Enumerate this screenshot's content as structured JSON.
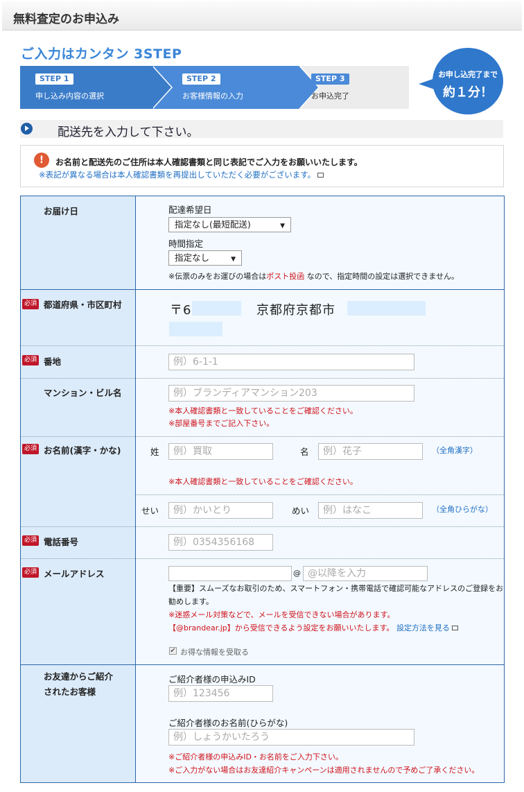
{
  "page": {
    "title": "無料査定のお申込み"
  },
  "steps": {
    "heading": "ご入力はカンタン 3STEP",
    "items": [
      {
        "badge": "STEP 1",
        "label": "申し込み内容の選択"
      },
      {
        "badge": "STEP 2",
        "label": "お客様情報の入力"
      },
      {
        "badge": "STEP 3",
        "label": "お申込完了"
      }
    ],
    "bubble_line1": "お申し込完了まで",
    "bubble_line2": "約１分！"
  },
  "section": {
    "heading": "配送先を入力して下さい。"
  },
  "notice": {
    "icon": "!",
    "line1": "お名前と配送先のご住所は本人確認書類と同じ表記でご入力をお願いいたします。",
    "line2": "※表記が異なる場合は本人確認書類を再提出していただく必要がございます。"
  },
  "form": {
    "required_label": "必須",
    "delivery": {
      "label": "お届け日",
      "date_label": "配達希望日",
      "date_value": "指定なし(最短配送)",
      "time_label": "時間指定",
      "time_value": "指定なし",
      "note_prefix": "※伝票のみをお運びの場合は",
      "note_link": "ポスト投函",
      "note_suffix": "なので、指定時間の設定は選択できません。"
    },
    "prefecture": {
      "label": "都道府県・市区町村",
      "zip_prefix": "〒6",
      "city": "京都府京都市"
    },
    "street": {
      "label": "番地",
      "placeholder": "例）6-1-1"
    },
    "building": {
      "label": "マンション・ビル名",
      "placeholder": "例）ブランディアマンション203",
      "note1": "※本人確認書類と一致していることをご確認ください。",
      "note2": "※部屋番号までご記入下さい。"
    },
    "name": {
      "label": "お名前(漢字・かな)",
      "sei_label": "姓",
      "sei_placeholder": "例）買取",
      "mei_label": "名",
      "mei_placeholder": "例）花子",
      "kanji_hint": "（全角漢字）",
      "note": "※本人確認書類と一致していることをご確認ください。",
      "kana_sei_label": "せい",
      "kana_sei_placeholder": "例）かいとり",
      "kana_mei_label": "めい",
      "kana_mei_placeholder": "例）はなこ",
      "kana_hint": "（全角ひらがな）"
    },
    "phone": {
      "label": "電話番号",
      "placeholder": "例）0354356168"
    },
    "email": {
      "label": "メールアドレス",
      "at": "@",
      "domain_placeholder": "@以降を入力",
      "important1": "【重要】スムーズなお取引のため、スマートフォン・携帯電話で確認可能なアドレスのご登録をお",
      "important2": "勧めします。",
      "warn": "※迷惑メール対策などで、メールを受信できない場合があります。",
      "domain_note": "【@brandear.jp】から受信できるよう設定をお願いいたします。",
      "settings_link": "設定方法を見る",
      "optin_label": "お得な情報を受取る"
    },
    "referral": {
      "label_line1": "お友達からご紹介",
      "label_line2": "されたお客様",
      "id_label": "ご紹介者様の申込みID",
      "id_placeholder": "例）123456",
      "name_label": "ご紹介者様のお名前(ひらがな)",
      "name_placeholder": "例）しょうかいたろう",
      "note1": "※ご紹介者様の申込みID・お名前をご入力下さい。",
      "note2": "※ご入力がない場合はお友達紹介キャンペーンは適用されませんので予めご了承ください。"
    }
  }
}
